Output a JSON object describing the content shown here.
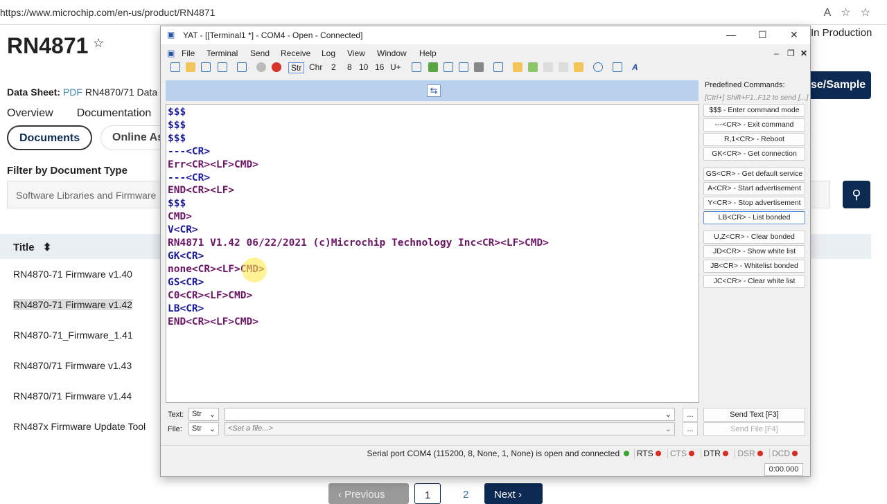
{
  "browser": {
    "url": "https://www.microchip.com/en-us/product/RN4871"
  },
  "page": {
    "title": "RN4871",
    "status": "In Production",
    "datasheet_label": "Data Sheet:",
    "datasheet_pdf": "PDF",
    "datasheet_name": "RN4870/71 Data",
    "tabs": [
      "Overview",
      "Documentation"
    ],
    "pills": [
      "Documents",
      "Online As"
    ],
    "filter_label": "Filter by Document Type",
    "filter_value": "Software Libraries and Firmware",
    "buy_button": "se/Sample",
    "table_header": "Title",
    "rows": [
      "RN4870-71 Firmware v1.40",
      "RN4870-71 Firmware v1.42",
      "RN4870-71_Firmware_1.41",
      "RN4870/71 Firmware v1.43",
      "RN4870/71 Firmware v1.44",
      "RN487x Firmware Update Tool"
    ],
    "pager": {
      "previous": "Previous",
      "page1": "1",
      "page2": "2",
      "next": "Next"
    }
  },
  "yat": {
    "title": "YAT - [[Terminal1 *] - COM4 - Open - Connected]",
    "menu": [
      "File",
      "Terminal",
      "Send",
      "Receive",
      "Log",
      "View",
      "Window",
      "Help"
    ],
    "radix": [
      "Str",
      "Chr",
      "2",
      "8",
      "10",
      "16",
      "U+"
    ],
    "terminal_lines": [
      {
        "t": "$$$",
        "dir": "tx"
      },
      {
        "t": "$$$",
        "dir": "tx"
      },
      {
        "t": "$$$",
        "dir": "tx"
      },
      {
        "t": "---<CR>",
        "dir": "tx"
      },
      {
        "t": "Err<CR><LF>CMD>",
        "dir": "rx"
      },
      {
        "t": "---<CR>",
        "dir": "tx"
      },
      {
        "t": "END<CR><LF>",
        "dir": "rx"
      },
      {
        "t": "$$$",
        "dir": "tx"
      },
      {
        "t": "CMD>",
        "dir": "rx"
      },
      {
        "t": "V<CR>",
        "dir": "tx"
      },
      {
        "t": "RN4871 V1.42 06/22/2021 (c)Microchip Technology Inc<CR><LF>CMD>",
        "dir": "rx"
      },
      {
        "t": "GK<CR>",
        "dir": "tx"
      },
      {
        "t": "none<CR><LF>CMD>",
        "dir": "rx"
      },
      {
        "t": "GS<CR>",
        "dir": "tx"
      },
      {
        "t": "C0<CR><LF>CMD>",
        "dir": "rx"
      },
      {
        "t": "LB<CR>",
        "dir": "tx"
      },
      {
        "t": "END<CR><LF>CMD>",
        "dir": "rx"
      }
    ],
    "predefined_label": "Predefined Commands:",
    "predefined_hint": "[Ctrl+] Shift+F1..F12 to send [...]",
    "predefined": [
      "$$$ - Enter command mode",
      "---<CR> - Exit command",
      "R,1<CR> - Reboot",
      "GK<CR> - Get connection",
      "GS<CR> - Get default service",
      "A<CR> - Start advertisement",
      "Y<CR> - Stop advertisement",
      "LB<CR> - List bonded",
      "U,Z<CR> - Clear bonded",
      "JD<CR> - Show white list",
      "JB<CR> - Whitelist bonded",
      "JC<CR> - Clear white list"
    ],
    "text_label": "Text:",
    "file_label": "File:",
    "text_mode": "Str",
    "file_mode": "Str",
    "text_value": "",
    "file_placeholder": "<Set a file...>",
    "browse": "...",
    "send_text": "Send Text [F3]",
    "send_file": "Send File [F4]",
    "status": "Serial port COM4 (115200, 8, None, 1, None) is open and connected",
    "signals": [
      "RTS",
      "CTS",
      "DTR",
      "DSR",
      "DCD"
    ],
    "timer": "0:00.000"
  }
}
